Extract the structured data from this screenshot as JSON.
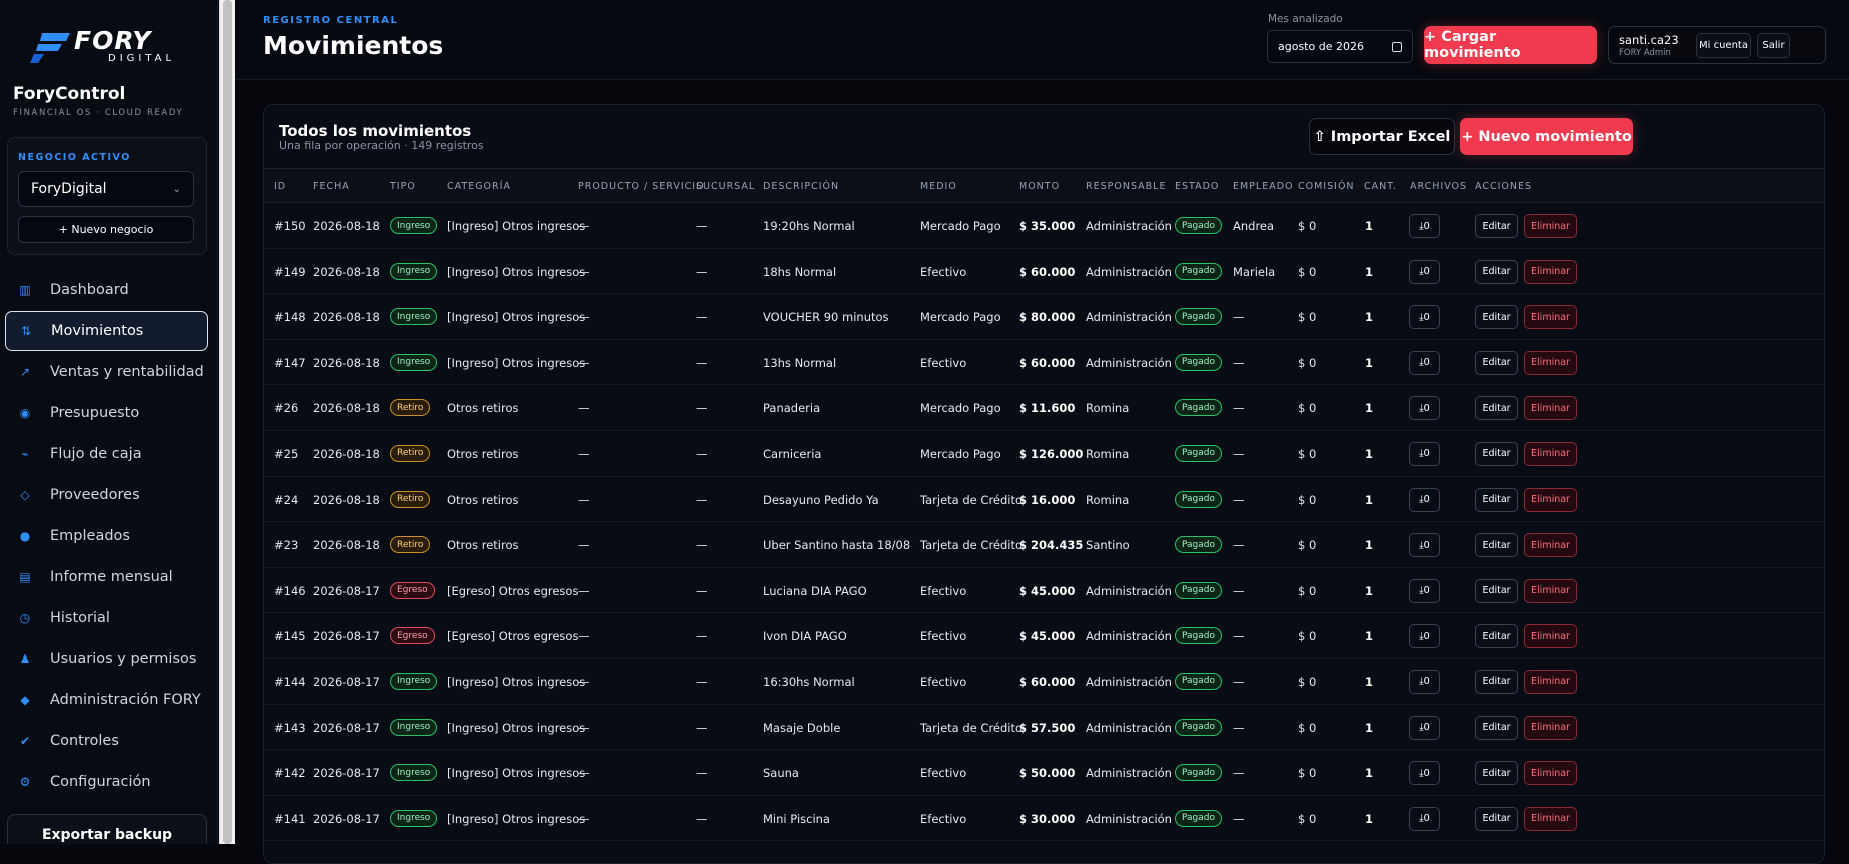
{
  "sidebar": {
    "logo_main": "FORY",
    "logo_sub": "DIGITAL",
    "app_name": "ForyControl",
    "app_tagline": "FINANCIAL OS · CLOUD READY",
    "business": {
      "label": "NEGOCIO ACTIVO",
      "selected": "ForyDigital",
      "new_button": "+ Nuevo negocio"
    },
    "nav": [
      {
        "label": "Dashboard",
        "icon": "dashboard-icon",
        "glyph": "▥"
      },
      {
        "label": "Movimientos",
        "icon": "transfer-icon",
        "glyph": "⇅",
        "active": true
      },
      {
        "label": "Ventas y rentabilidad",
        "icon": "trend-up-icon",
        "glyph": "↗"
      },
      {
        "label": "Presupuesto",
        "icon": "budget-icon",
        "glyph": "◉"
      },
      {
        "label": "Flujo de caja",
        "icon": "flow-icon",
        "glyph": "⌁"
      },
      {
        "label": "Proveedores",
        "icon": "diamond-outline-icon",
        "glyph": "◇"
      },
      {
        "label": "Empleados",
        "icon": "people-icon",
        "glyph": "●"
      },
      {
        "label": "Informe mensual",
        "icon": "report-icon",
        "glyph": "▤"
      },
      {
        "label": "Historial",
        "icon": "clock-icon",
        "glyph": "◷"
      },
      {
        "label": "Usuarios y permisos",
        "icon": "user-icon",
        "glyph": "♟"
      },
      {
        "label": "Administración FORY",
        "icon": "diamond-icon",
        "glyph": "◆"
      },
      {
        "label": "Controles",
        "icon": "check-icon",
        "glyph": "✔"
      },
      {
        "label": "Configuración",
        "icon": "gear-icon",
        "glyph": "⚙"
      }
    ],
    "export_label": "Exportar backup"
  },
  "header": {
    "kicker": "REGISTRO CENTRAL",
    "title": "Movimientos",
    "month_label": "Mes analizado",
    "month_value": "agosto de 2026",
    "load_button": "+ Cargar movimiento",
    "user": {
      "name": "santi.ca23",
      "role": "FORY Admin",
      "account_button": "Mi cuenta",
      "logout_button": "Salir"
    }
  },
  "card": {
    "title": "Todos los movimientos",
    "subtitle": "Una fila por operación · 149 registros",
    "import_button": "⇧ Importar Excel",
    "new_button": "+ Nuevo movimiento"
  },
  "table": {
    "columns": [
      "ID",
      "FECHA",
      "TIPO",
      "CATEGORÍA",
      "PRODUCTO / SERVICIO",
      "SUCURSAL",
      "DESCRIPCIÓN",
      "MEDIO",
      "MONTO",
      "RESPONSABLE",
      "ESTADO",
      "EMPLEADO",
      "COMISIÓN",
      "CANT.",
      "ARCHIVOS",
      "ACCIONES"
    ],
    "edit_label": "Editar",
    "delete_label": "Eliminar",
    "rows": [
      {
        "id": "#150",
        "fecha": "2026-08-18",
        "tipo": "Ingreso",
        "categoria": "[Ingreso] Otros ingresos",
        "producto": "—",
        "sucursal": "—",
        "descripcion": "19:20hs Normal",
        "medio": "Mercado Pago",
        "monto": "$ 35.000",
        "responsable": "Administración",
        "estado": "Pagado",
        "empleado": "Andrea",
        "comision": "$ 0",
        "cant": "1",
        "archivos": "⤓0"
      },
      {
        "id": "#149",
        "fecha": "2026-08-18",
        "tipo": "Ingreso",
        "categoria": "[Ingreso] Otros ingresos",
        "producto": "—",
        "sucursal": "—",
        "descripcion": "18hs Normal",
        "medio": "Efectivo",
        "monto": "$ 60.000",
        "responsable": "Administración",
        "estado": "Pagado",
        "empleado": "Mariela",
        "comision": "$ 0",
        "cant": "1",
        "archivos": "⤓0"
      },
      {
        "id": "#148",
        "fecha": "2026-08-18",
        "tipo": "Ingreso",
        "categoria": "[Ingreso] Otros ingresos",
        "producto": "—",
        "sucursal": "—",
        "descripcion": "VOUCHER 90 minutos",
        "medio": "Mercado Pago",
        "monto": "$ 80.000",
        "responsable": "Administración",
        "estado": "Pagado",
        "empleado": "—",
        "comision": "$ 0",
        "cant": "1",
        "archivos": "⤓0"
      },
      {
        "id": "#147",
        "fecha": "2026-08-18",
        "tipo": "Ingreso",
        "categoria": "[Ingreso] Otros ingresos",
        "producto": "—",
        "sucursal": "—",
        "descripcion": "13hs Normal",
        "medio": "Efectivo",
        "monto": "$ 60.000",
        "responsable": "Administración",
        "estado": "Pagado",
        "empleado": "—",
        "comision": "$ 0",
        "cant": "1",
        "archivos": "⤓0"
      },
      {
        "id": "#26",
        "fecha": "2026-08-18",
        "tipo": "Retiro",
        "categoria": "Otros retiros",
        "producto": "—",
        "sucursal": "—",
        "descripcion": "Panaderia",
        "medio": "Mercado Pago",
        "monto": "$ 11.600",
        "responsable": "Romina",
        "estado": "Pagado",
        "empleado": "—",
        "comision": "$ 0",
        "cant": "1",
        "archivos": "⤓0"
      },
      {
        "id": "#25",
        "fecha": "2026-08-18",
        "tipo": "Retiro",
        "categoria": "Otros retiros",
        "producto": "—",
        "sucursal": "—",
        "descripcion": "Carniceria",
        "medio": "Mercado Pago",
        "monto": "$ 126.000",
        "responsable": "Romina",
        "estado": "Pagado",
        "empleado": "—",
        "comision": "$ 0",
        "cant": "1",
        "archivos": "⤓0"
      },
      {
        "id": "#24",
        "fecha": "2026-08-18",
        "tipo": "Retiro",
        "categoria": "Otros retiros",
        "producto": "—",
        "sucursal": "—",
        "descripcion": "Desayuno Pedido Ya",
        "medio": "Tarjeta de Crédito",
        "monto": "$ 16.000",
        "responsable": "Romina",
        "estado": "Pagado",
        "empleado": "—",
        "comision": "$ 0",
        "cant": "1",
        "archivos": "⤓0"
      },
      {
        "id": "#23",
        "fecha": "2026-08-18",
        "tipo": "Retiro",
        "categoria": "Otros retiros",
        "producto": "—",
        "sucursal": "—",
        "descripcion": "Uber Santino hasta 18/08",
        "medio": "Tarjeta de Crédito",
        "monto": "$ 204.435",
        "responsable": "Santino",
        "estado": "Pagado",
        "empleado": "—",
        "comision": "$ 0",
        "cant": "1",
        "archivos": "⤓0"
      },
      {
        "id": "#146",
        "fecha": "2026-08-17",
        "tipo": "Egreso",
        "categoria": "[Egreso] Otros egresos",
        "producto": "—",
        "sucursal": "—",
        "descripcion": "Luciana DIA PAGO",
        "medio": "Efectivo",
        "monto": "$ 45.000",
        "responsable": "Administración",
        "estado": "Pagado",
        "empleado": "—",
        "comision": "$ 0",
        "cant": "1",
        "archivos": "⤓0"
      },
      {
        "id": "#145",
        "fecha": "2026-08-17",
        "tipo": "Egreso",
        "categoria": "[Egreso] Otros egresos",
        "producto": "—",
        "sucursal": "—",
        "descripcion": "Ivon DIA PAGO",
        "medio": "Efectivo",
        "monto": "$ 45.000",
        "responsable": "Administración",
        "estado": "Pagado",
        "empleado": "—",
        "comision": "$ 0",
        "cant": "1",
        "archivos": "⤓0"
      },
      {
        "id": "#144",
        "fecha": "2026-08-17",
        "tipo": "Ingreso",
        "categoria": "[Ingreso] Otros ingresos",
        "producto": "—",
        "sucursal": "—",
        "descripcion": "16:30hs Normal",
        "medio": "Efectivo",
        "monto": "$ 60.000",
        "responsable": "Administración",
        "estado": "Pagado",
        "empleado": "—",
        "comision": "$ 0",
        "cant": "1",
        "archivos": "⤓0"
      },
      {
        "id": "#143",
        "fecha": "2026-08-17",
        "tipo": "Ingreso",
        "categoria": "[Ingreso] Otros ingresos",
        "producto": "—",
        "sucursal": "—",
        "descripcion": "Masaje Doble",
        "medio": "Tarjeta de Crédito",
        "monto": "$ 57.500",
        "responsable": "Administración",
        "estado": "Pagado",
        "empleado": "—",
        "comision": "$ 0",
        "cant": "1",
        "archivos": "⤓0"
      },
      {
        "id": "#142",
        "fecha": "2026-08-17",
        "tipo": "Ingreso",
        "categoria": "[Ingreso] Otros ingresos",
        "producto": "—",
        "sucursal": "—",
        "descripcion": "Sauna",
        "medio": "Efectivo",
        "monto": "$ 50.000",
        "responsable": "Administración",
        "estado": "Pagado",
        "empleado": "—",
        "comision": "$ 0",
        "cant": "1",
        "archivos": "⤓0"
      },
      {
        "id": "#141",
        "fecha": "2026-08-17",
        "tipo": "Ingreso",
        "categoria": "[Ingreso] Otros ingresos",
        "producto": "—",
        "sucursal": "—",
        "descripcion": "Mini Piscina",
        "medio": "Efectivo",
        "monto": "$ 30.000",
        "responsable": "Administración",
        "estado": "Pagado",
        "empleado": "—",
        "comision": "$ 0",
        "cant": "1",
        "archivos": "⤓0"
      }
    ]
  }
}
